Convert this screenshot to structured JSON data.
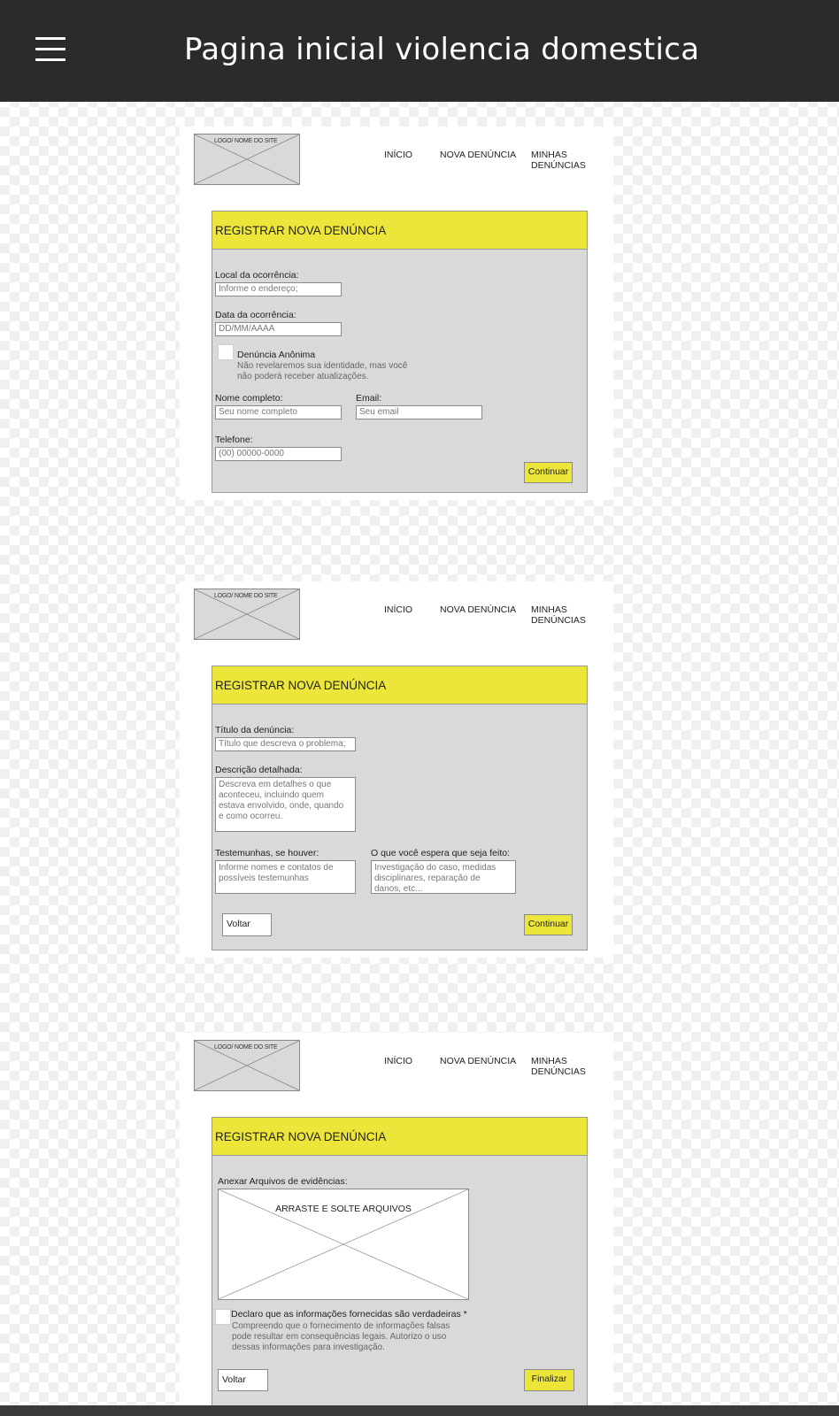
{
  "app": {
    "title": "Pagina inicial violencia domestica"
  },
  "site": {
    "logo_text": "LOGO/ NOME DO SITE",
    "nav": {
      "inicio": "INÍCIO",
      "nova": "NOVA DENÚNCIA",
      "minhas": "MINHAS DENÚNCIAS"
    }
  },
  "panel_title": "REGISTRAR NOVA DENÚNCIA",
  "step1": {
    "local_label": "Local da ocorrência:",
    "local_placeholder": "Informe o endereço;",
    "data_label": "Data da ocorrência:",
    "data_placeholder": "DD/MM/AAAA",
    "anon_label": "Denúncia Anônima",
    "anon_helper_1": "Não revelaremos sua identidade, mas você",
    "anon_helper_2": "não poderá receber atualizações.",
    "nome_label": "Nome completo:",
    "nome_placeholder": "Seu nome completo",
    "email_label": "Email:",
    "email_placeholder": "Seu email",
    "telefone_label": "Telefone:",
    "telefone_placeholder": "(00) 00000-0000",
    "continue_label": "Continuar"
  },
  "step2": {
    "titulo_label": "Título da denúncia:",
    "titulo_placeholder": "Título que descreva o problema;",
    "descricao_label": "Descrição detalhada:",
    "descricao_lines": [
      "Descreva em detalhes o que",
      "aconteceu, incluindo quem",
      "estava envolvido, onde, quando",
      "e como ocorreu."
    ],
    "testemunhas_label": "Testemunhas, se houver:",
    "testemunhas_lines": [
      "Informe nomes e contatos de",
      "possíveis testemunhas"
    ],
    "espera_label": "O que você espera que seja feito:",
    "espera_lines": [
      "Investigação do caso, medidas",
      "disciplinares, reparação de",
      "danos, etc..."
    ],
    "back_label": "Voltar",
    "continue_label": "Continuar"
  },
  "step3": {
    "anexar_label": "Anexar Arquivos de evidências:",
    "dropzone_label": "ARRASTE E SOLTE ARQUIVOS",
    "declaro_label": "Declaro que as informações fornecidas são verdadeiras *",
    "declaro_helper": [
      "Compreendo que o fornecimento de informações falsas",
      "pode resultar em consequências legais. Autorizo o uso",
      "dessas informações para investigação."
    ],
    "back_label": "Voltar",
    "finish_label": "Finalizar"
  },
  "colors": {
    "accent": "#ece53a",
    "topbar": "#2b2b2b",
    "panel": "#d9d9d9"
  },
  "icons": {
    "menu": "hamburger-menu-icon",
    "logo": "image-placeholder-icon"
  }
}
